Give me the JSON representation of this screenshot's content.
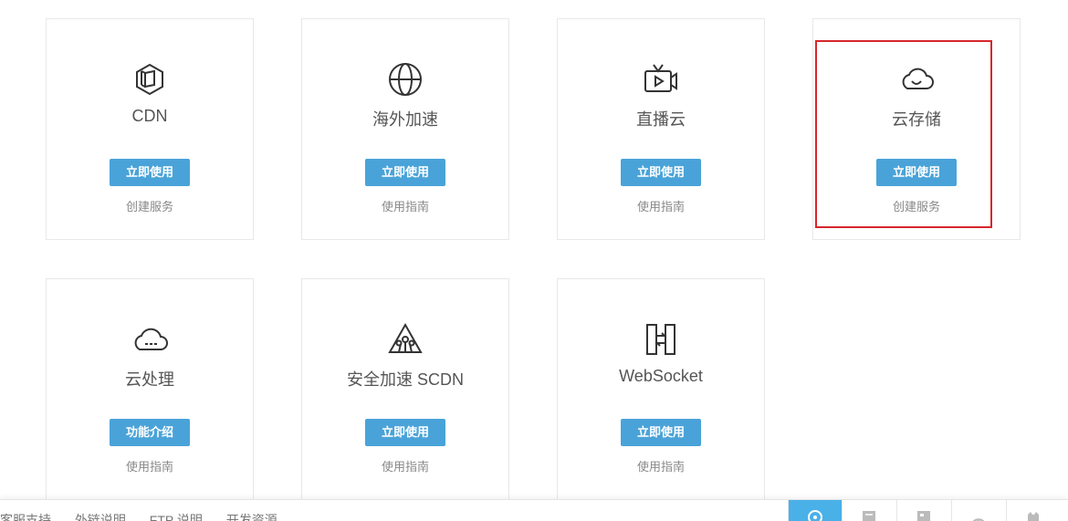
{
  "cards": [
    {
      "title": "CDN",
      "button": "立即使用",
      "link": "创建服务",
      "icon": "hexagon-cube-icon"
    },
    {
      "title": "海外加速",
      "button": "立即使用",
      "link": "使用指南",
      "icon": "globe-icon"
    },
    {
      "title": "直播云",
      "button": "立即使用",
      "link": "使用指南",
      "icon": "tv-play-icon"
    },
    {
      "title": "云存储",
      "button": "立即使用",
      "link": "创建服务",
      "icon": "cloud-smile-icon"
    },
    {
      "title": "云处理",
      "button": "功能介绍",
      "link": "使用指南",
      "icon": "cloud-dash-icon"
    },
    {
      "title": "安全加速 SCDN",
      "button": "立即使用",
      "link": "使用指南",
      "icon": "triangle-network-icon"
    },
    {
      "title": "WebSocket",
      "button": "立即使用",
      "link": "使用指南",
      "icon": "websocket-arrows-icon"
    }
  ],
  "footer": {
    "links": [
      "客服支持",
      "外链说明",
      "FTP 说明",
      "开发资源"
    ],
    "tools": [
      "compass-icon",
      "document-icon",
      "chart-icon",
      "broadcast-icon",
      "github-icon"
    ]
  },
  "colors": {
    "button": "#4aa3d8",
    "highlight": "#d7262b",
    "tool_active": "#4ab0e8"
  }
}
